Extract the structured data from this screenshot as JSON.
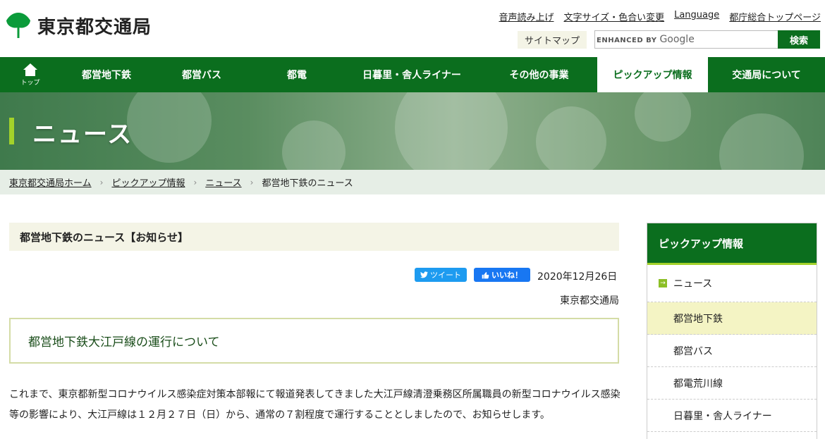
{
  "header": {
    "logo_text": "東京都交通局",
    "util_links": [
      "音声読み上げ",
      "文字サイズ・色合い変更",
      "Language",
      "都庁総合トップページ"
    ],
    "sitemap_label": "サイトマップ",
    "search": {
      "enhanced_by": "ENHANCED BY",
      "google": "Google",
      "button_label": "検索"
    }
  },
  "nav": {
    "home_label": "トップ",
    "items": [
      "都営地下鉄",
      "都営バス",
      "都電",
      "日暮里・舎人ライナー",
      "その他の事業",
      "ピックアップ情報",
      "交通局について"
    ],
    "active_index": 5
  },
  "hero": {
    "title": "ニュース"
  },
  "breadcrumb": {
    "items": [
      "東京都交通局ホーム",
      "ピックアップ情報",
      "ニュース",
      "都営地下鉄のニュース"
    ]
  },
  "article": {
    "section_heading": "都営地下鉄のニュース【お知らせ】",
    "tweet_label": "ツイート",
    "like_label": "いいね！",
    "date": "2020年12月26日",
    "publisher": "東京都交通局",
    "title": "都営地下鉄大江戸線の運行について",
    "body_line1": "これまで、東京都新型コロナウイルス感染症対策本部報にて報道発表してきました大江戸線清澄乗務区所属職員の新型コロナウイルス感染",
    "body_line2": "等の影響により、大江戸線は１２月２７日（日）から、通常の７割程度で運行することとしましたので、お知らせします。"
  },
  "sidebar": {
    "heading": "ピックアップ情報",
    "items": [
      "ニュース",
      "都営地下鉄",
      "都営バス",
      "都電荒川線",
      "日暮里・舎人ライナー"
    ],
    "current_index": 1
  },
  "colors": {
    "brand_green": "#0b6e1e",
    "accent_lime": "#a3d22a",
    "heading_bg": "#f4f4e6"
  }
}
